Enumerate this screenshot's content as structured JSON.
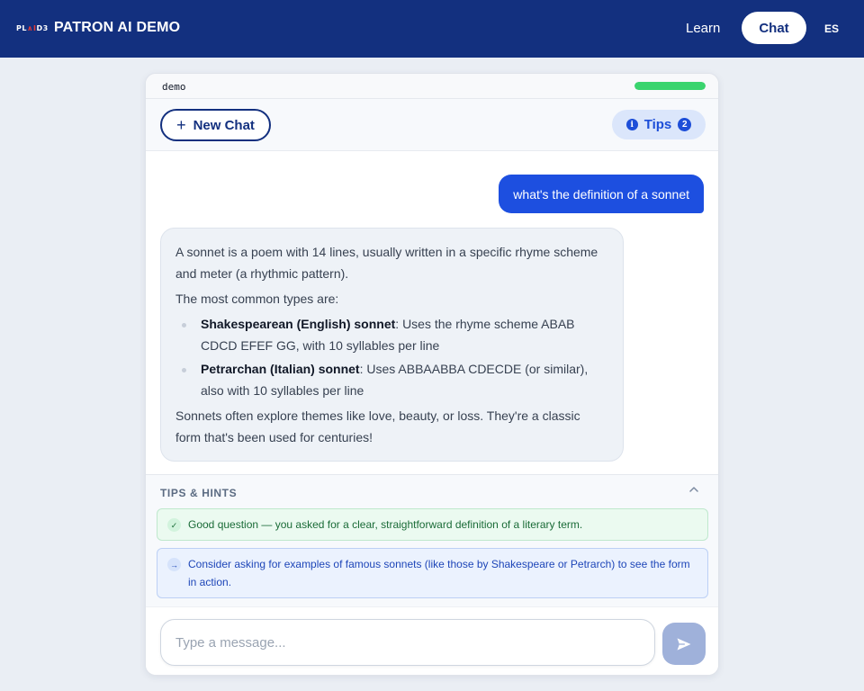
{
  "header": {
    "logo_text_part1": "PL",
    "logo_text_accent": "∧I",
    "logo_text_part2": "D3",
    "title": "PATRON AI DEMO",
    "nav": {
      "learn": "Learn",
      "chat": "Chat",
      "language": "ES"
    }
  },
  "session": {
    "label": "demo",
    "progress_fraction": 1.0,
    "progress_color": "#3ad46e"
  },
  "toolbar": {
    "new_chat_icon": "plus-icon",
    "new_chat_label": "New Chat",
    "tips_icon": "info-icon",
    "tips_label": "Tips",
    "tips_count": "2"
  },
  "messages": {
    "user": "what's the definition of a sonnet",
    "assistant": {
      "intro": "A sonnet is a poem with 14 lines, usually written in a specific rhyme scheme and meter (a rhythmic pattern).",
      "types_heading": "The most common types are:",
      "types": [
        {
          "name": "Shakespearean (English) sonnet",
          "desc": ": Uses the rhyme scheme ABAB CDCD EFEF GG, with 10 syllables per line"
        },
        {
          "name": "Petrarchan (Italian) sonnet",
          "desc": ": Uses ABBAABBA CDECDE (or similar), also with 10 syllables per line"
        }
      ],
      "closing": "Sonnets often explore themes like love, beauty, or loss. They're a classic form that's been used for centuries!"
    }
  },
  "hints": {
    "title": "TIPS & HINTS",
    "collapse_icon": "chevron-up-icon",
    "items": [
      {
        "kind": "good",
        "icon": "check-icon",
        "text": "Good question — you asked for a clear, straightforward definition of a literary term."
      },
      {
        "kind": "suggestion",
        "icon": "arrow-right-icon",
        "text": "Consider asking for examples of famous sonnets (like those by Shakespeare or Petrarch) to see the form in action."
      }
    ]
  },
  "composer": {
    "placeholder": "Type a message...",
    "send_icon": "send-icon"
  },
  "colors": {
    "brand_navy": "#13307f",
    "user_bubble": "#1d4fe0",
    "tips_accent": "#1d4ed8",
    "send_button": "#9fb1da"
  }
}
